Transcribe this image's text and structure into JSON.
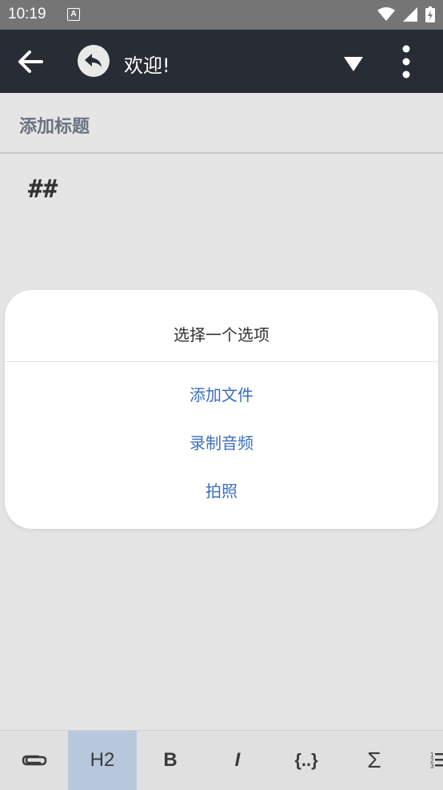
{
  "status_bar": {
    "time": "10:19",
    "notification_letter": "A"
  },
  "app_bar": {
    "title": "欢迎!"
  },
  "note": {
    "title_placeholder": "添加标题",
    "body": "##"
  },
  "dialog": {
    "title": "选择一个选项",
    "options": [
      "添加文件",
      "录制音频",
      "拍照"
    ]
  },
  "toolbar": {
    "items": [
      {
        "icon": "paperclip-icon",
        "label": ""
      },
      {
        "icon": "heading-icon",
        "label": "H2"
      },
      {
        "icon": "bold-icon",
        "label": "B"
      },
      {
        "icon": "italic-icon",
        "label": "I"
      },
      {
        "icon": "code-block-icon",
        "label": "{..}"
      },
      {
        "icon": "sigma-icon",
        "label": "Σ"
      },
      {
        "icon": "numbered-list-icon",
        "label": ""
      }
    ]
  },
  "colors": {
    "app_bar": "#282c34",
    "accent": "#3b6fc0",
    "active_tool": "#b8c8dc"
  }
}
